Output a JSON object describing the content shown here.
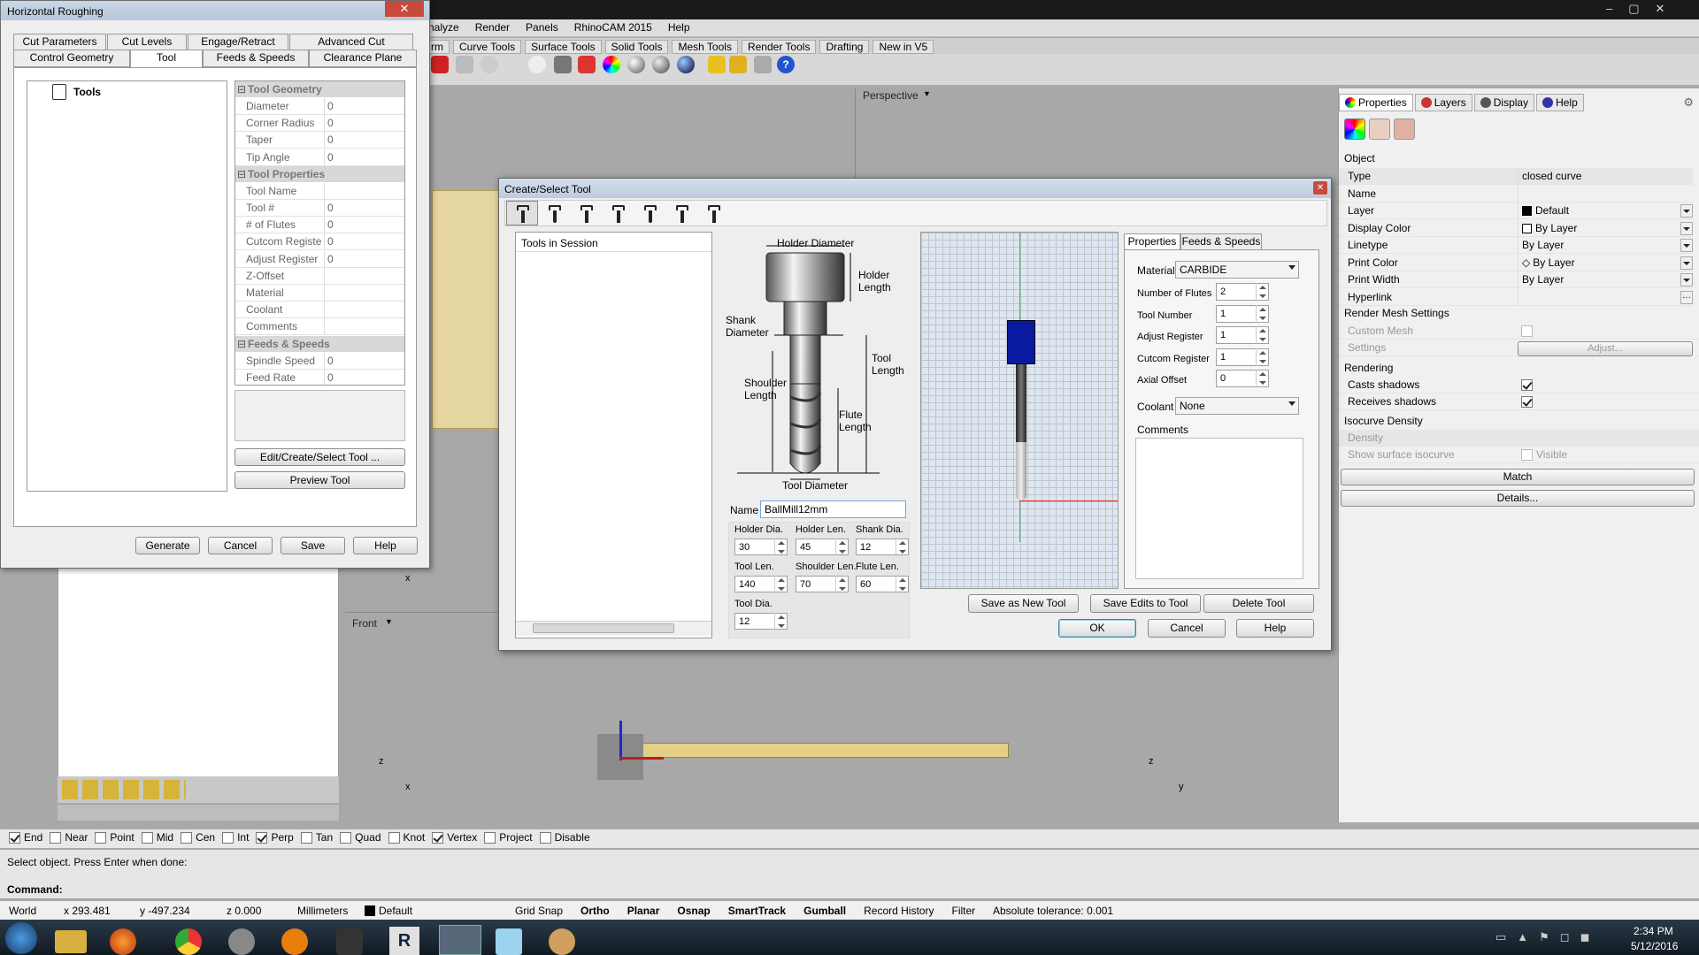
{
  "rhino": {
    "menu": [
      "nalyze",
      "Render",
      "Panels",
      "RhinoCAM 2015",
      "Help"
    ],
    "toolbar_tabs": [
      "rm",
      "Curve Tools",
      "Surface Tools",
      "Solid Tools",
      "Mesh Tools",
      "Render Tools",
      "Drafting",
      "New in V5"
    ],
    "viewport_top": "Perspective",
    "viewport_bottom": "Front",
    "axis_x": "x",
    "axis_y": "y",
    "axis_z": "z"
  },
  "hr": {
    "title": "Horizontal Roughing",
    "tabs_row1": [
      "Cut Parameters",
      "Cut Levels",
      "Engage/Retract",
      "Advanced Cut Parameters"
    ],
    "tabs_row2": [
      "Control Geometry",
      "Tool",
      "Feeds & Speeds",
      "Clearance Plane"
    ],
    "tree_root": "Tools",
    "sections": [
      {
        "title": "Tool Geometry",
        "rows": [
          [
            "Diameter",
            "0"
          ],
          [
            "Corner Radius",
            "0"
          ],
          [
            "Taper",
            "0"
          ],
          [
            "Tip Angle",
            "0"
          ]
        ]
      },
      {
        "title": "Tool Properties",
        "rows": [
          [
            "Tool Name",
            ""
          ],
          [
            "Tool #",
            "0"
          ],
          [
            "# of Flutes",
            "0"
          ],
          [
            "Cutcom Registe",
            "0"
          ],
          [
            "Adjust Register",
            "0"
          ],
          [
            "Z-Offset",
            ""
          ],
          [
            "Material",
            ""
          ],
          [
            "Coolant",
            ""
          ],
          [
            "Comments",
            ""
          ]
        ]
      },
      {
        "title": "Feeds & Speeds",
        "rows": [
          [
            "Spindle Speed",
            "0"
          ],
          [
            "Feed Rate",
            "0"
          ]
        ]
      }
    ],
    "edit_button": "Edit/Create/Select Tool ...",
    "preview_button": "Preview Tool",
    "generate": "Generate",
    "cancel": "Cancel",
    "save": "Save",
    "help": "Help"
  },
  "cst": {
    "title": "Create/Select Tool",
    "session_header": "Tools in Session",
    "diagram": {
      "holder_diameter": "Holder Diameter",
      "holder_length": "Holder Length",
      "shank_diameter": "Shank Diameter",
      "tool_length": "Tool Length",
      "shoulder_length": "Shoulder Length",
      "flute_length": "Flute Length",
      "tool_diameter": "Tool Diameter"
    },
    "name_label": "Name",
    "name_value": "BallMill12mm",
    "dims": [
      [
        "Holder Dia.",
        "30"
      ],
      [
        "Holder Len.",
        "45"
      ],
      [
        "Shank Dia.",
        "12"
      ],
      [
        "Tool Len.",
        "140"
      ],
      [
        "Shoulder Len.",
        "70"
      ],
      [
        "Flute Len.",
        "60"
      ],
      [
        "Tool Dia.",
        "12"
      ]
    ],
    "tab_properties": "Properties",
    "tab_feeds": "Feeds & Speeds",
    "material_label": "Material",
    "material_value": "CARBIDE",
    "props": [
      [
        "Number of Flutes",
        "2"
      ],
      [
        "Tool Number",
        "1"
      ],
      [
        "Adjust Register",
        "1"
      ],
      [
        "Cutcom Register",
        "1"
      ],
      [
        "Axial Offset",
        "0"
      ]
    ],
    "coolant_label": "Coolant",
    "coolant_value": "None",
    "comments_label": "Comments",
    "save_new": "Save as New Tool",
    "save_edits": "Save Edits to Tool",
    "delete": "Delete Tool",
    "ok": "OK",
    "cancel": "Cancel",
    "help": "Help"
  },
  "props_panel": {
    "tabs": [
      "Properties",
      "Layers",
      "Display",
      "Help"
    ],
    "object_header": "Object",
    "rows": [
      [
        "Type",
        "closed curve"
      ],
      [
        "Name",
        ""
      ],
      [
        "Layer",
        "Default"
      ],
      [
        "Display Color",
        "By Layer"
      ],
      [
        "Linetype",
        "By Layer"
      ],
      [
        "Print Color",
        "By Layer"
      ],
      [
        "Print Width",
        "By Layer"
      ],
      [
        "Hyperlink",
        ""
      ]
    ],
    "render_mesh": "Render Mesh Settings",
    "custom_mesh": "Custom Mesh",
    "settings": "Settings",
    "adjust": "Adjust...",
    "rendering": "Rendering",
    "casts": "Casts shadows",
    "receives": "Receives shadows",
    "isocurve": "Isocurve Density",
    "density": "Density",
    "show_iso": "Show surface isocurve",
    "visible": "Visible",
    "match": "Match",
    "details": "Details..."
  },
  "osnap": [
    [
      "End",
      true
    ],
    [
      "Near",
      false
    ],
    [
      "Point",
      false
    ],
    [
      "Mid",
      false
    ],
    [
      "Cen",
      false
    ],
    [
      "Int",
      false
    ],
    [
      "Perp",
      true
    ],
    [
      "Tan",
      false
    ],
    [
      "Quad",
      false
    ],
    [
      "Knot",
      false
    ],
    [
      "Vertex",
      true
    ],
    [
      "Project",
      false
    ],
    [
      "Disable",
      false
    ]
  ],
  "command": {
    "history": "Select object. Press Enter when done:",
    "prompt": "Command:"
  },
  "status": {
    "world": "World",
    "x": "x 293.481",
    "y": "y -497.234",
    "z": "z 0.000",
    "units": "Millimeters",
    "layer": "Default",
    "items": [
      "Grid Snap",
      "Ortho",
      "Planar",
      "Osnap",
      "SmartTrack",
      "Gumball",
      "Record History",
      "Filter"
    ],
    "tolerance": "Absolute tolerance: 0.001"
  },
  "clock": {
    "time": "2:34 PM",
    "date": "5/12/2016"
  }
}
